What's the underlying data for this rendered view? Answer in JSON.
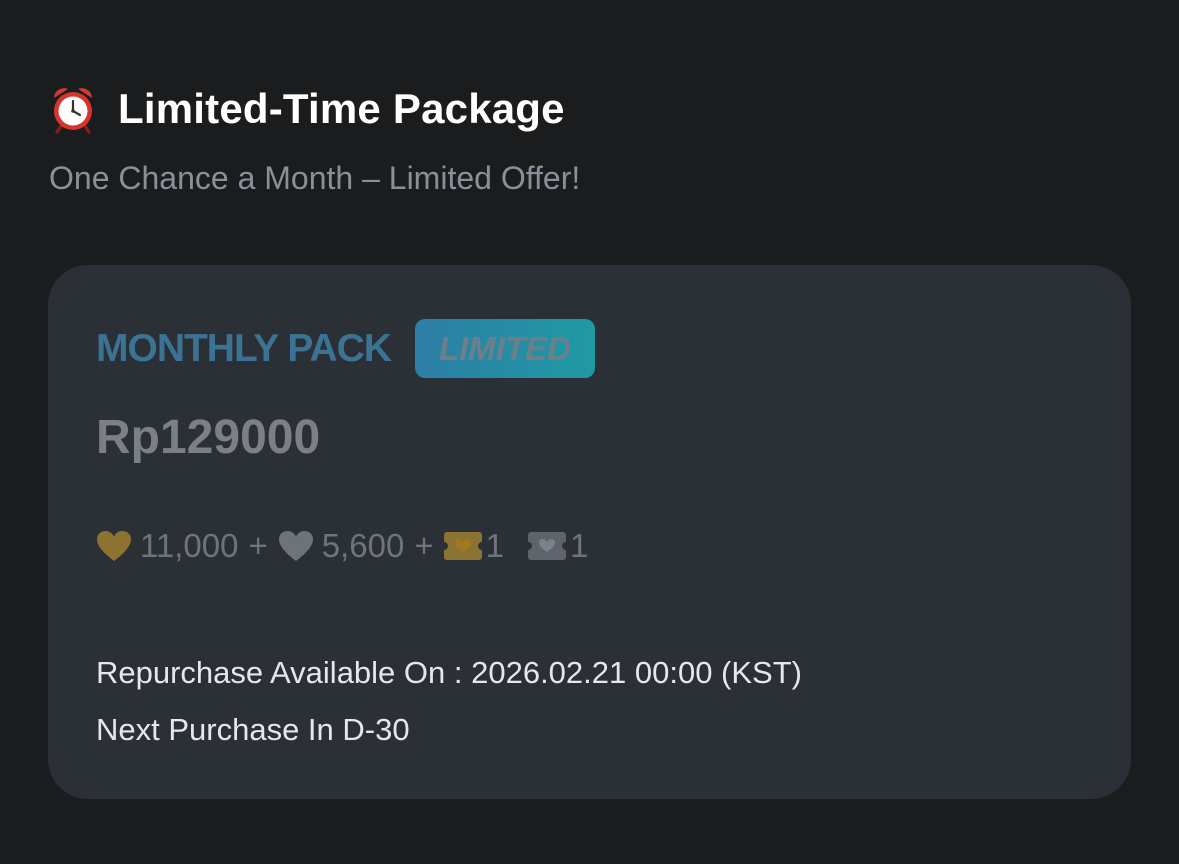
{
  "header": {
    "icon": "alarm-clock-icon",
    "title": "Limited-Time Package",
    "subtitle": "One Chance a Month – Limited Offer!"
  },
  "package": {
    "name": "MONTHLY PACK",
    "badge": "LIMITED",
    "price": "Rp129000",
    "items": {
      "gold_hearts": "11,000",
      "silver_hearts": "5,600",
      "plus": "+",
      "gold_ticket_count": "1",
      "silver_ticket_count": "1",
      "gold_icon": "gold-heart-icon",
      "silver_icon": "silver-heart-icon",
      "gold_ticket_icon": "gold-ticket-icon",
      "silver_ticket_icon": "silver-ticket-icon"
    },
    "repurchase_text": "Repurchase Available On : 2026.02.21 00:00 (KST)",
    "next_purchase_text": "Next Purchase In D-30"
  },
  "colors": {
    "background": "#1b1c1e",
    "card": "#2b2f36",
    "accent_gold": "#8c7430",
    "accent_silver": "#6e727b",
    "badge_start": "#2d7ea5",
    "badge_end": "#1f9aa3",
    "pack_name": "#3b7394"
  }
}
